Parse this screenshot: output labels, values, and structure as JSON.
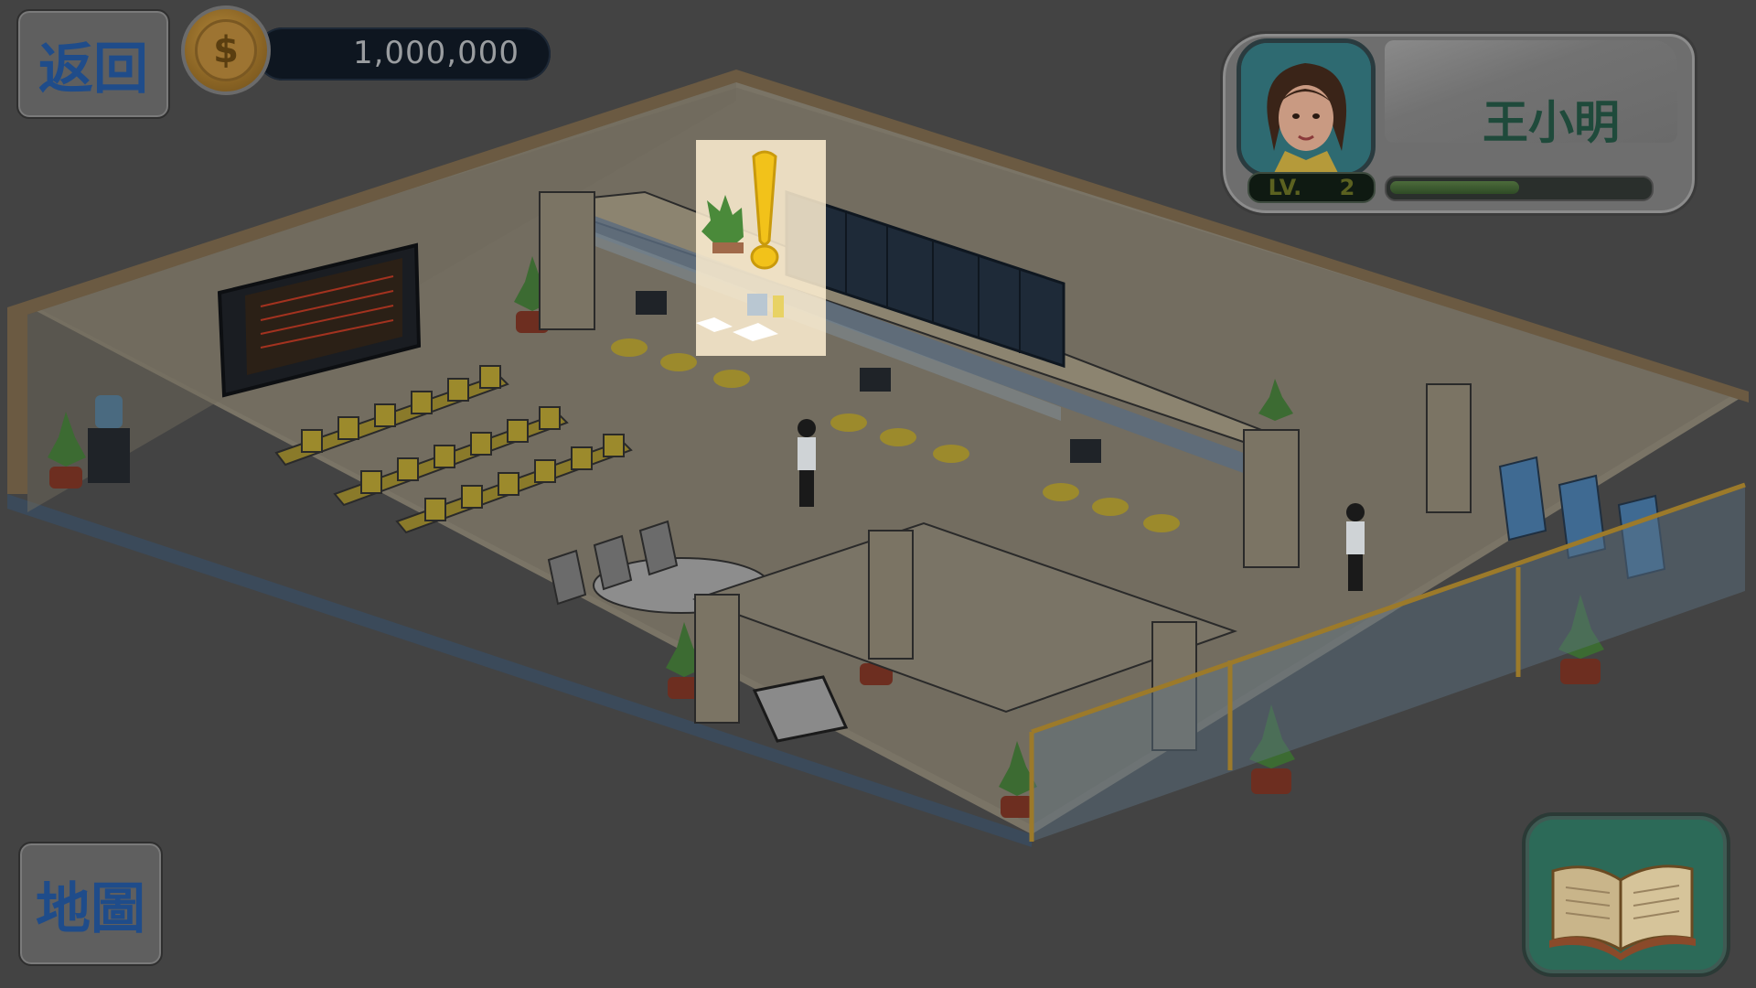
{
  "hud": {
    "back_label": "返回",
    "map_label": "地圖"
  },
  "currency": {
    "icon": "coin-icon",
    "symbol": "$",
    "amount": "1,000,000"
  },
  "player": {
    "name": "王小明",
    "level_prefix": "LV.",
    "level": "2",
    "xp_progress": 0.5,
    "avatar": "avatar-portrait-icon"
  },
  "quest": {
    "marker_icon": "exclamation-icon"
  },
  "guide": {
    "icon": "open-book-icon"
  },
  "colors": {
    "background": "#434343",
    "hud_text": "#1f4c8a",
    "name_text": "#1f4a3b",
    "highlight": "#fff0d2",
    "exclamation": "#f2c21a"
  }
}
